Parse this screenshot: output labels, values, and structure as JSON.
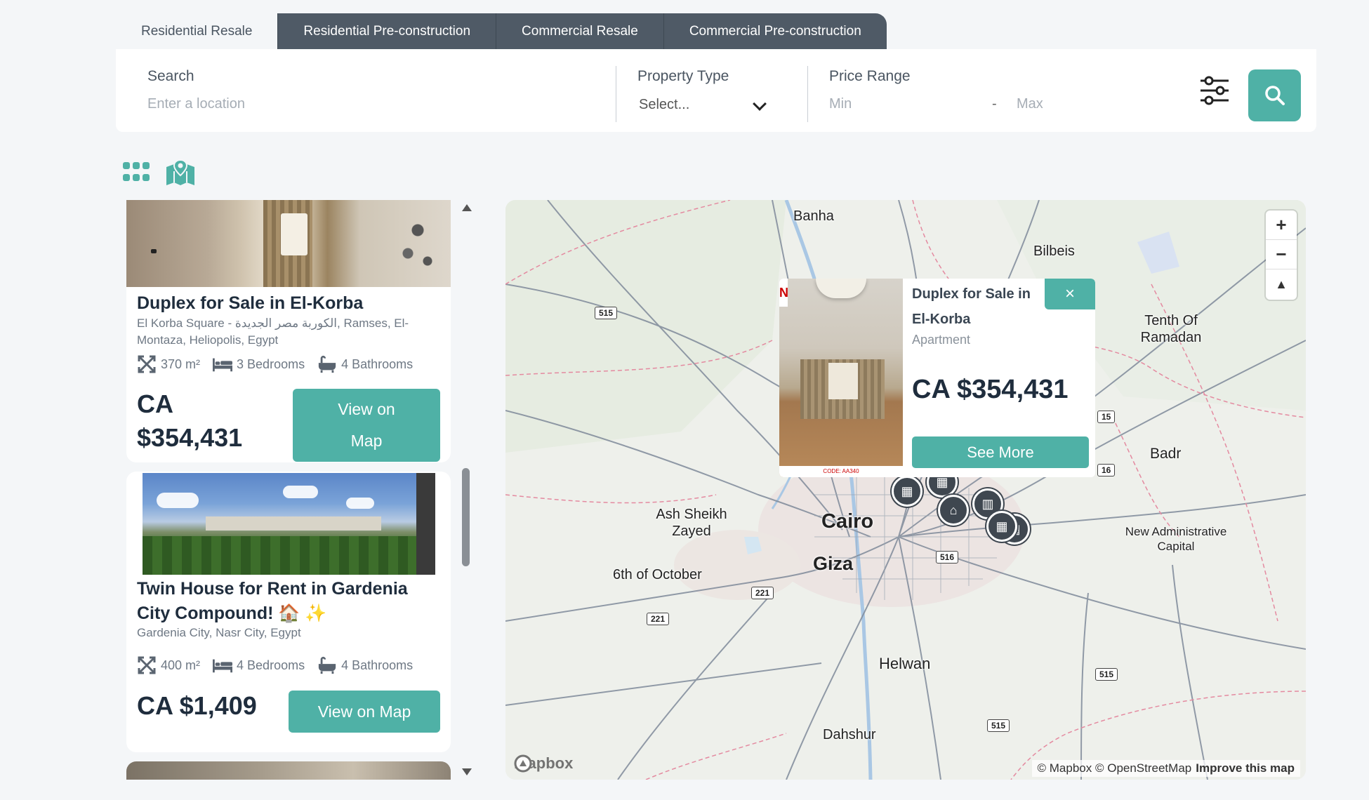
{
  "tabs": [
    "Residential Resale",
    "Residential Pre-construction",
    "Commercial Resale",
    "Commercial Pre-construction"
  ],
  "search": {
    "label": "Search",
    "placeholder": "Enter a location",
    "property_type_label": "Property Type",
    "property_type_value": "Select...",
    "price_label": "Price Range",
    "min_placeholder": "Min",
    "dash": "-",
    "max_placeholder": "Max"
  },
  "listings": [
    {
      "title": "Duplex for Sale in El-Korba",
      "address": "El Korba Square - الكوربة مصر الجديدة, Ramses, El-Montaza, Heliopolis, Egypt",
      "area": "370 m²",
      "bedrooms": "3 Bedrooms",
      "bathrooms": "4 Bathrooms",
      "price_currency": "CA",
      "price_amount": "$354,431",
      "button": "View on Map"
    },
    {
      "title": "Twin House for Rent in Gardenia City Compound! 🏠 ✨",
      "address": "Gardenia City, Nasr City, Egypt",
      "area": "400 m²",
      "bedrooms": "4 Bedrooms",
      "bathrooms": "4 Bathrooms",
      "price": "CA $1,409",
      "button": "View on Map"
    }
  ],
  "map": {
    "cities": [
      "Banha",
      "Bilbeis",
      "Tenth Of Ramadan",
      "Badr",
      "Ash Sheikh Zayed",
      "Cairo",
      "Giza",
      "6th of October",
      "New Administrative Capital",
      "Helwan",
      "Dahshur"
    ],
    "roads": [
      "515",
      "15",
      "16",
      "516",
      "221",
      "221",
      "515",
      "515"
    ],
    "zoom_in": "+",
    "zoom_out": "−",
    "compass": "▲",
    "attribution": "© Mapbox © OpenStreetMap",
    "improve": "Improve this map",
    "logo": "mapbox",
    "popup": {
      "title": "Duplex for Sale in El-Korba",
      "type": "Apartment",
      "price": "CA $354,431",
      "button": "See More",
      "close": "×",
      "photo_code": "CODE: AA340"
    }
  },
  "colors": {
    "accent": "#4fb1a6",
    "tab_dark": "#4f5a66"
  }
}
